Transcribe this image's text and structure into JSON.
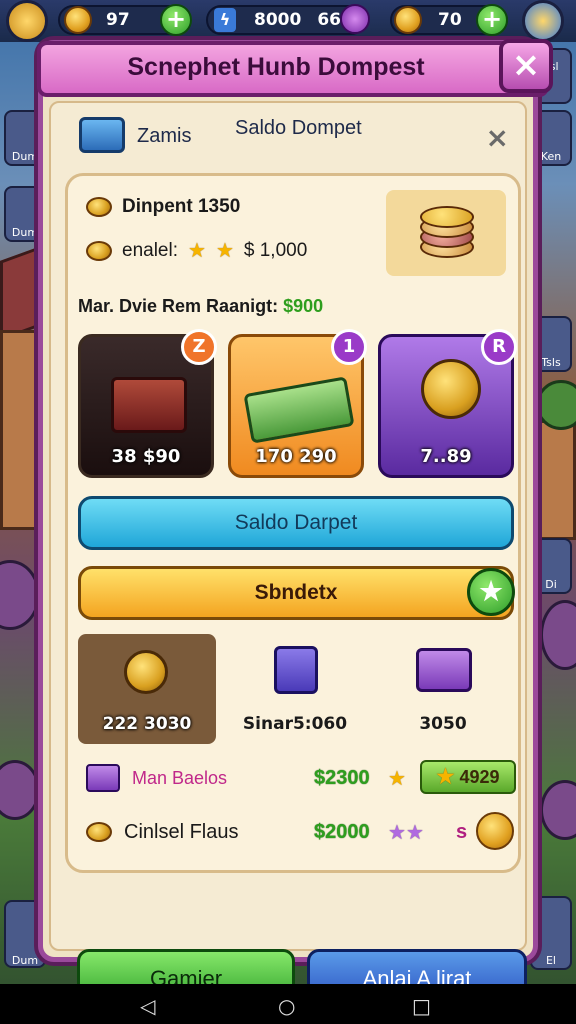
{
  "topbar": {
    "res1_value": "97",
    "res2_value": "8000",
    "res3_value": "66",
    "res4_value": "70"
  },
  "side": {
    "left_tile_1": "Dum",
    "left_tile_2": "Dum",
    "right_tile_1": "ksl",
    "right_tile_2": "Ken",
    "right_tile_3": "Tsls",
    "right_tile_4": "Di",
    "right_tile_5": "El"
  },
  "modal": {
    "title": "Scnephet Hunb Dompest",
    "close_label": "×"
  },
  "header_row": {
    "name": "Zamis",
    "center_label": "Saldo Dompet",
    "dismiss": "×"
  },
  "info": {
    "line1": "Dinpent 1350",
    "line2_label": "enalel:",
    "line2_value": "$ 1,000",
    "highlight_label": "Mar. Dvie Rem Raanigt:",
    "highlight_value": "$900"
  },
  "offers": [
    {
      "value": "38 $90",
      "badge": "Z"
    },
    {
      "value": "170 290",
      "badge": "1"
    },
    {
      "value": "7..89",
      "badge": "R"
    }
  ],
  "buttons": {
    "blue_bar": "Saldo Darpet",
    "yellow_bar": "Sbndetx",
    "star_icon": "★",
    "bottom_left": "Gamier",
    "bottom_right": "Anlai A lirat"
  },
  "minis": [
    {
      "value": "222 3030"
    },
    {
      "value": "Sinar5:060"
    },
    {
      "value": "3050"
    }
  ],
  "rows": [
    {
      "label": "Man Baelos",
      "money": "$2300",
      "pill": "4929"
    },
    {
      "label": "Cinlsel Flaus",
      "money": "$2000",
      "s_mark": "s"
    }
  ],
  "navbar": {
    "back": "◁",
    "home": "○",
    "recent": "□"
  },
  "colors": {
    "modal_border": "#9b4a9b",
    "header_pink": "#d86ac6",
    "money_green": "#2e9e1e",
    "accent_yellow": "#f4a420",
    "accent_blue": "#1fa6d8"
  }
}
